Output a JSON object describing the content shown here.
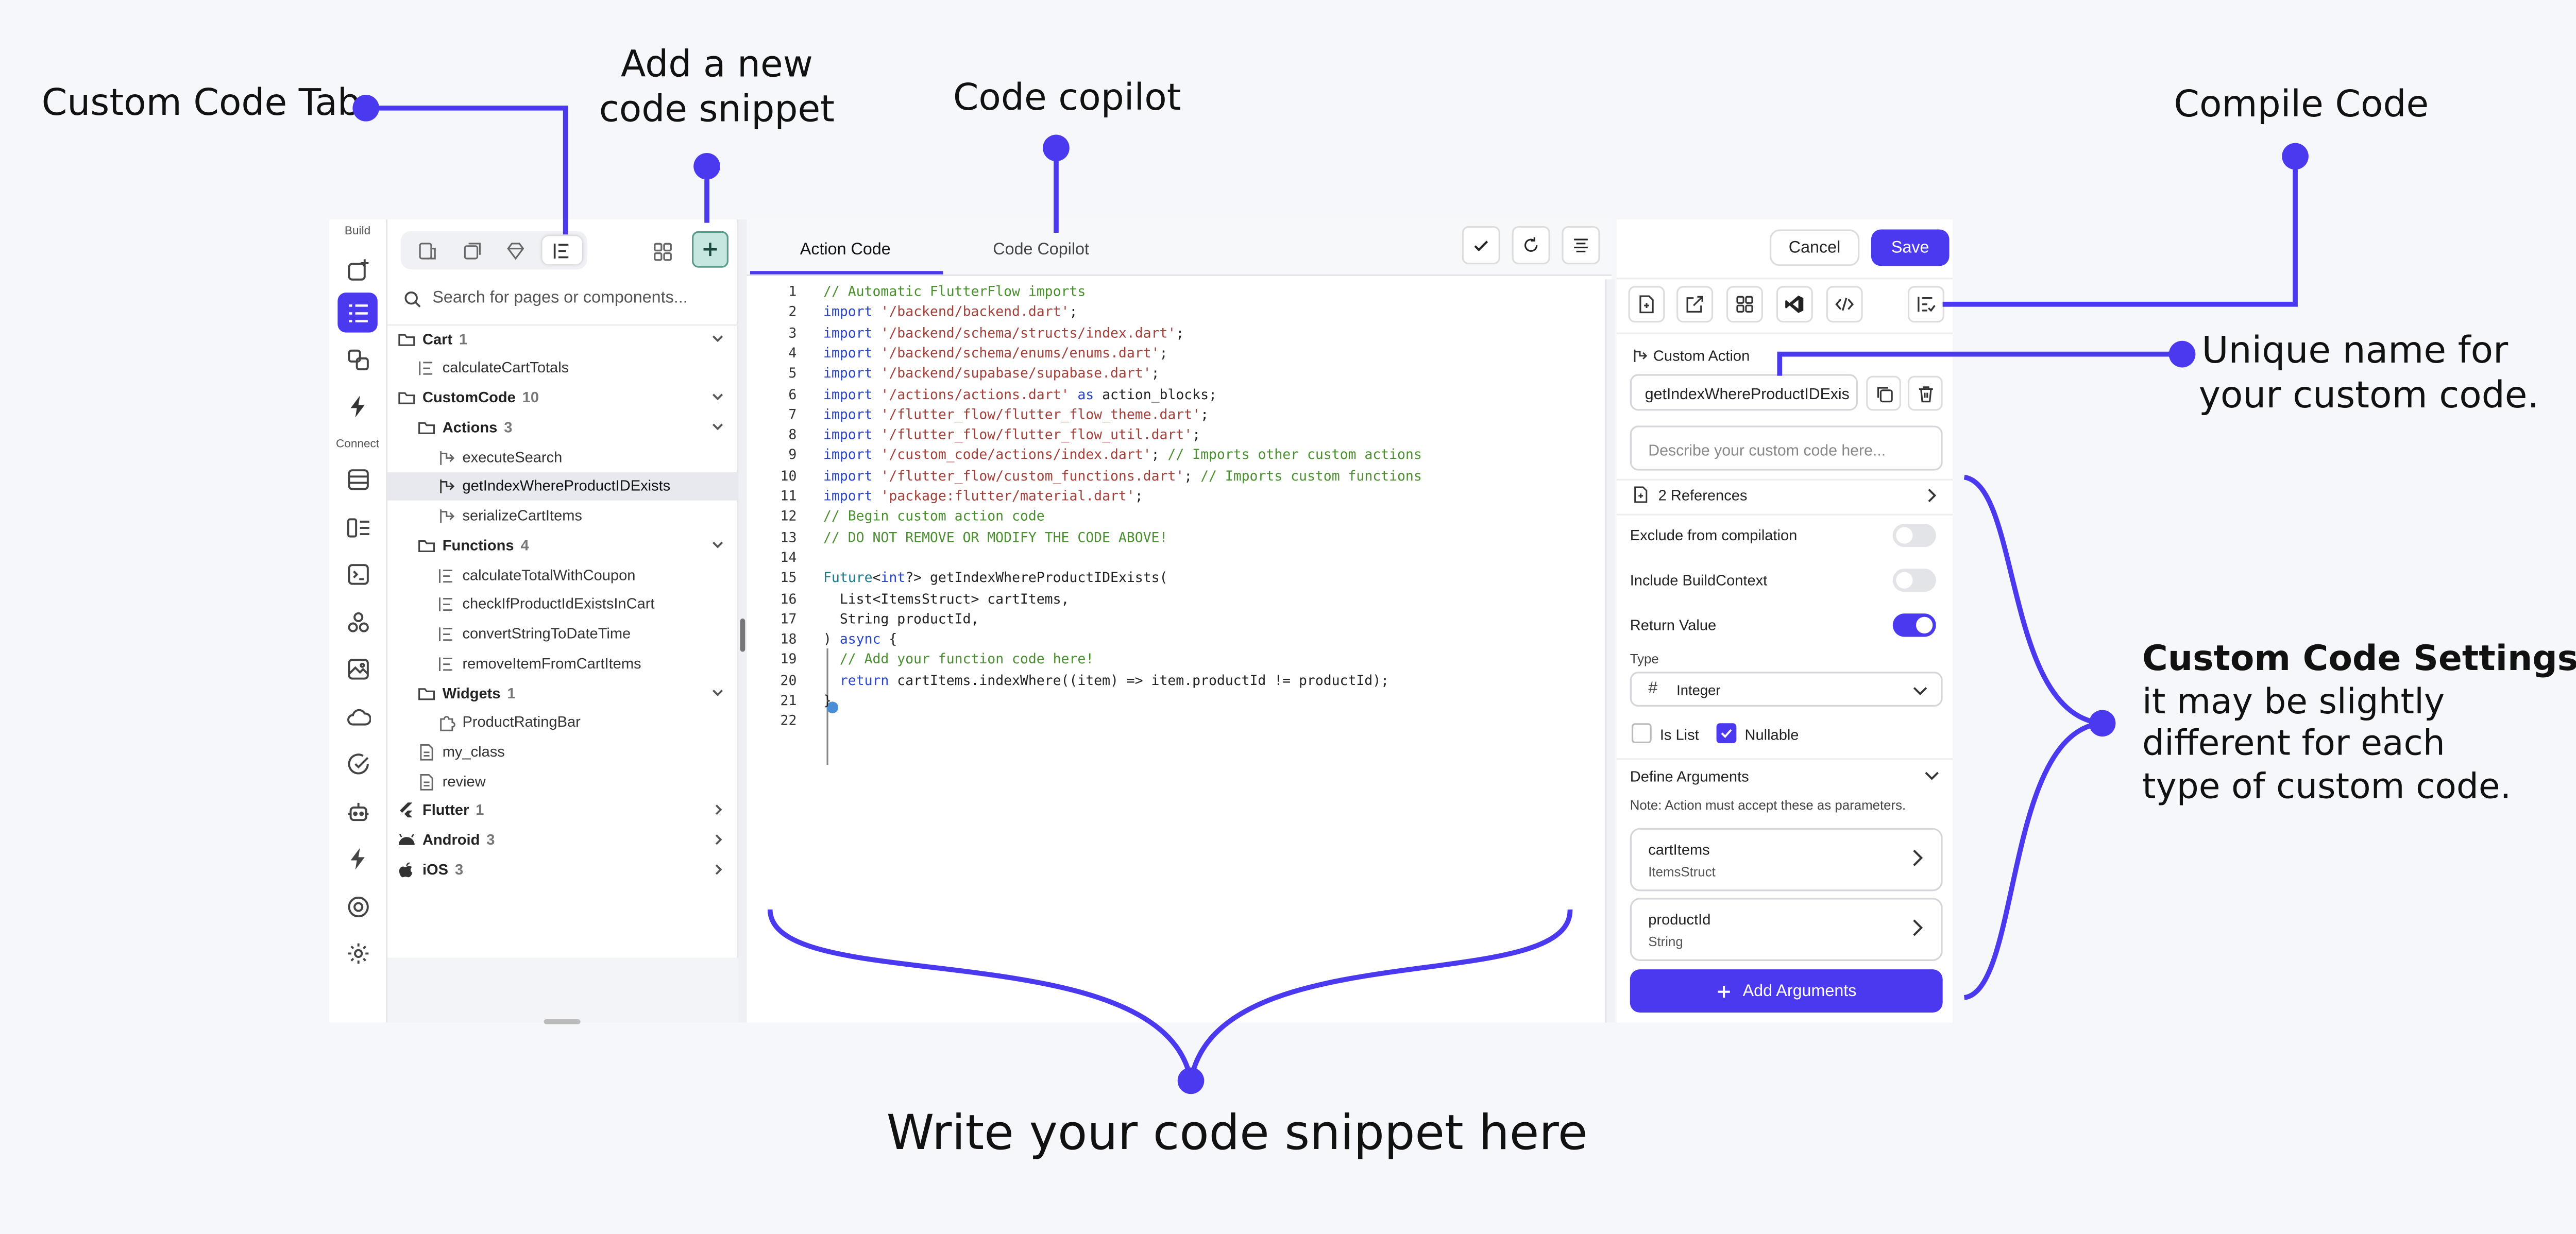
{
  "annotations": {
    "custom_code_tab": "Custom Code Tab",
    "add_snippet": [
      "Add a new",
      "code snippet"
    ],
    "code_copilot": "Code copilot",
    "compile_code": "Compile Code",
    "unique_name": [
      "Unique name for",
      "your custom code."
    ],
    "settings_title": "Custom Code Settings:",
    "settings_lines": [
      "it may be slightly",
      "different for each",
      "type of custom code."
    ],
    "write_snippet": "Write your code snippet here"
  },
  "accent": "#4b39ef",
  "rail": {
    "build_label": "Build",
    "connect_label": "Connect"
  },
  "nav": {
    "search_placeholder": "Search for pages or components...",
    "tree": [
      {
        "label": "Cart",
        "count": "1"
      },
      {
        "label": "calculateCartTotals",
        "count": ""
      },
      {
        "label": "CustomCode",
        "count": "10"
      },
      {
        "label": "Actions",
        "count": "3"
      },
      {
        "label": "executeSearch",
        "count": ""
      },
      {
        "label": "getIndexWhereProductIDExists",
        "count": ""
      },
      {
        "label": "serializeCartItems",
        "count": ""
      },
      {
        "label": "Functions",
        "count": "4"
      },
      {
        "label": "calculateTotalWithCoupon",
        "count": ""
      },
      {
        "label": "checkIfProductIdExistsInCart",
        "count": ""
      },
      {
        "label": "convertStringToDateTime",
        "count": ""
      },
      {
        "label": "removeItemFromCartItems",
        "count": ""
      },
      {
        "label": "Widgets",
        "count": "1"
      },
      {
        "label": "ProductRatingBar",
        "count": ""
      },
      {
        "label": "my_class",
        "count": ""
      },
      {
        "label": "review",
        "count": ""
      },
      {
        "label": "Flutter",
        "count": "1"
      },
      {
        "label": "Android",
        "count": "3"
      },
      {
        "label": "iOS",
        "count": "3"
      }
    ]
  },
  "editor": {
    "tabs": [
      "Action Code",
      "Code Copilot"
    ],
    "lines": [
      "// Automatic FlutterFlow imports",
      "import '/backend/backend.dart';",
      "import '/backend/schema/structs/index.dart';",
      "import '/backend/schema/enums/enums.dart';",
      "import '/backend/supabase/supabase.dart';",
      "import '/actions/actions.dart' as action_blocks;",
      "import '/flutter_flow/flutter_flow_theme.dart';",
      "import '/flutter_flow/flutter_flow_util.dart';",
      "import '/custom_code/actions/index.dart'; // Imports other custom actions",
      "import '/flutter_flow/custom_functions.dart'; // Imports custom functions",
      "import 'package:flutter/material.dart';",
      "// Begin custom action code",
      "// DO NOT REMOVE OR MODIFY THE CODE ABOVE!",
      "",
      "Future<int?> getIndexWhereProductIDExists(",
      "  List<ItemsStruct> cartItems,",
      "  String productId,",
      ") async {",
      "  // Add your function code here!",
      "  return cartItems.indexWhere((item) => item.productId != productId);",
      "}",
      ""
    ]
  },
  "settings": {
    "cancel": "Cancel",
    "save": "Save",
    "type_label": "Custom Action",
    "name_value": "getIndexWhereProductIDExis",
    "description_placeholder": "Describe your custom code here...",
    "references": "2 References",
    "exclude": "Exclude from compilation",
    "include_ctx": "Include BuildContext",
    "return_value": "Return Value",
    "type_heading": "Type",
    "type_value": "Integer",
    "is_list": "Is List",
    "nullable": "Nullable",
    "define_args": "Define Arguments",
    "note": "Note: Action must accept these as parameters.",
    "args": [
      {
        "name": "cartItems",
        "type": "ItemsStruct"
      },
      {
        "name": "productId",
        "type": "String"
      }
    ],
    "add_args": "Add Arguments"
  }
}
